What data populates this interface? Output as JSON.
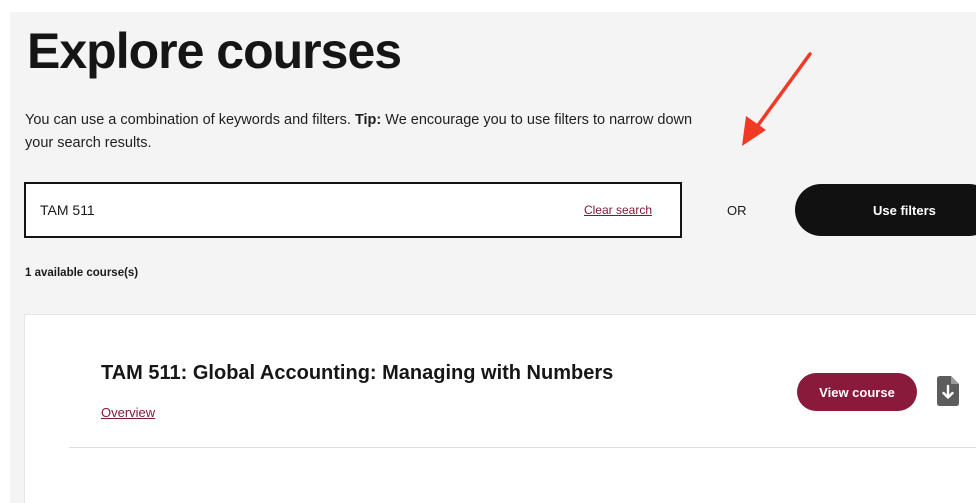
{
  "header": {
    "title": "Explore courses",
    "intro_text": "You can use a combination of keywords and filters. ",
    "tip_label": "Tip:",
    "tip_text": " We encourage you to use filters to narrow down your search results."
  },
  "search": {
    "value": "TAM 511",
    "placeholder": "",
    "clear_label": "Clear search",
    "or_label": "OR",
    "filters_label": "Use filters"
  },
  "results": {
    "count_label": "1 available course(s)",
    "courses": [
      {
        "title": "TAM 511: Global Accounting: Managing with Numbers",
        "overview_label": "Overview",
        "view_label": "View course",
        "download_icon": "download-document-icon"
      }
    ]
  },
  "annotation": {
    "arrow_icon": "red-arrow-icon",
    "arrow_color": "#f03a24"
  },
  "colors": {
    "accent": "#8a1a3b",
    "link": "#7a1a35",
    "dark_button": "#111111",
    "panel_bg": "#f4f4f4"
  }
}
